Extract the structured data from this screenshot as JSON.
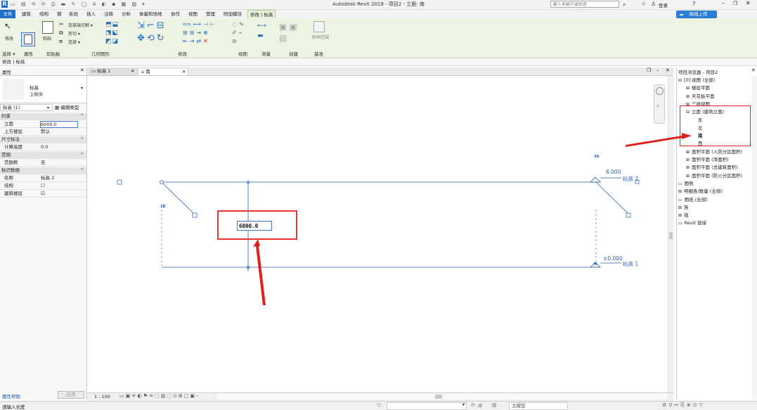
{
  "app": {
    "title": "Autodesk Revit 2019 - 项目2 - 立面: 南",
    "search_placeholder": "键入关键字或短语",
    "login": "登录"
  },
  "ribbon": {
    "tabs": [
      "文件",
      "建筑",
      "结构",
      "钢",
      "系统",
      "插入",
      "注释",
      "分析",
      "体量和场地",
      "协作",
      "视图",
      "管理",
      "附加模块",
      "修改 | 标高"
    ],
    "active_tab": "修改 | 标高",
    "cloud_button": "拖拽上传",
    "select_label": "选择 ▾",
    "modify_label": "修改",
    "paste_label": "粘贴",
    "cut_label": "剪切 ▾",
    "join_label": "连接 ▾",
    "cope_label": "连接端切割 ▾",
    "view_delete_label": "影响范围",
    "panels": [
      "选择",
      "属性",
      "剪贴板",
      "几何图形",
      "修改",
      "视图",
      "测量",
      "创建",
      "基准"
    ]
  },
  "modify_bar": "修改 | 标高",
  "properties": {
    "title": "属性",
    "type_name": "标高",
    "type_sub": "上标头",
    "instance_selector": "标高 (1)",
    "edit_type": "编辑类型",
    "rows": [
      {
        "kind": "group",
        "k": "约束"
      },
      {
        "kind": "row",
        "k": "立面",
        "v": "6000.0"
      },
      {
        "kind": "row",
        "k": "上方楼层",
        "v": "默认"
      },
      {
        "kind": "group",
        "k": "尺寸标注"
      },
      {
        "kind": "row",
        "k": "计算高度",
        "v": "0.0"
      },
      {
        "kind": "group",
        "k": "范围"
      },
      {
        "kind": "row",
        "k": "范围框",
        "v": "无"
      },
      {
        "kind": "group",
        "k": "标识数据"
      },
      {
        "kind": "row",
        "k": "名称",
        "v": "标高 2"
      },
      {
        "kind": "row",
        "k": "结构",
        "v": "☐"
      },
      {
        "kind": "row",
        "k": "建筑楼层",
        "v": "☑"
      }
    ],
    "help_link": "属性帮助",
    "apply": "应用"
  },
  "view_tabs": [
    {
      "label": "标高 1",
      "active": false
    },
    {
      "label": "南",
      "active": true
    }
  ],
  "drawing": {
    "level2_value": "6.000",
    "level2_name": "标高 2",
    "level1_value": "±0.000",
    "level1_name": "标高 1",
    "edit_value": "6000.0",
    "tag_3d": "3D"
  },
  "browser": {
    "title": "项目浏览器 - 项目2",
    "items": [
      {
        "label": "[0] 视图 (全部)",
        "indent": 0,
        "sign": "⊟"
      },
      {
        "label": "楼层平面",
        "indent": 1,
        "sign": "⊞"
      },
      {
        "label": "天花板平面",
        "indent": 1,
        "sign": "⊞"
      },
      {
        "label": "三维视图",
        "indent": 1,
        "sign": "⊞"
      },
      {
        "label": "立面 (建筑立面)",
        "indent": 1,
        "sign": "⊟"
      },
      {
        "label": "东",
        "indent": 2,
        "sign": ""
      },
      {
        "label": "北",
        "indent": 2,
        "sign": ""
      },
      {
        "label": "南",
        "indent": 2,
        "sign": "",
        "bold": true
      },
      {
        "label": "西",
        "indent": 2,
        "sign": ""
      },
      {
        "label": "面积平面 (人防分区面积)",
        "indent": 1,
        "sign": "⊞"
      },
      {
        "label": "面积平面 (净面积)",
        "indent": 1,
        "sign": "⊞"
      },
      {
        "label": "面积平面 (总建筑面积)",
        "indent": 1,
        "sign": "⊞"
      },
      {
        "label": "面积平面 (防火分区面积)",
        "indent": 1,
        "sign": "⊞"
      },
      {
        "label": "图例",
        "indent": 0,
        "sign": ""
      },
      {
        "label": "明细表/数量 (全部)",
        "indent": 0,
        "sign": "⊞"
      },
      {
        "label": "图纸 (全部)",
        "indent": 0,
        "sign": ""
      },
      {
        "label": "族",
        "indent": 0,
        "sign": "⊞"
      },
      {
        "label": "组",
        "indent": 0,
        "sign": "⊞"
      },
      {
        "label": "Revit 链接",
        "indent": 0,
        "sign": ""
      }
    ]
  },
  "view_control": {
    "scale": "1 : 100"
  },
  "status": {
    "message": "请输入长度",
    "model": "主模型",
    "zero": ":0"
  },
  "colors": {
    "accent_blue": "#1e6fc8",
    "annotation_red": "#e02020",
    "datum_blue": "#2a5fb0",
    "ribbon_green": "#eef4e4"
  }
}
